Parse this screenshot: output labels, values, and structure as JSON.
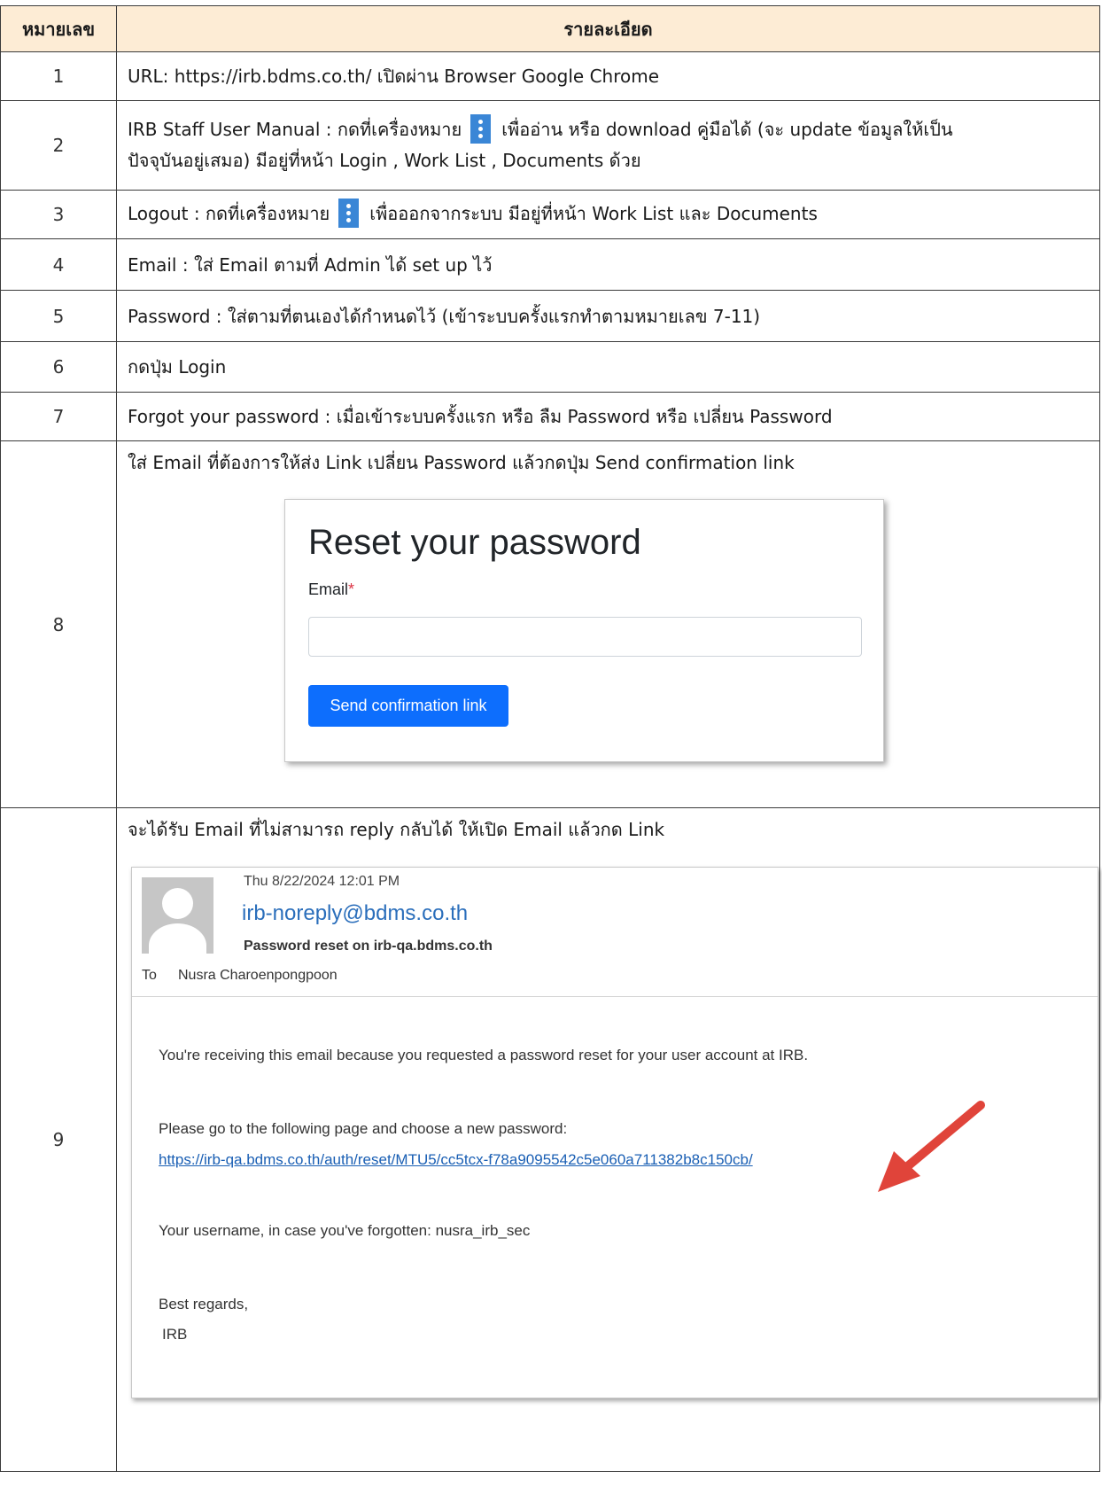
{
  "table": {
    "header": {
      "num": "หมายเลข",
      "desc": "รายละเอียด"
    },
    "rows": [
      {
        "num": "1",
        "text": "URL: https://irb.bdms.co.th/ เปิดผ่าน Browser Google Chrome"
      },
      {
        "num": "2",
        "text_before_icon": "IRB Staff User Manual : กดที่เครื่องหมาย",
        "text_after_icon": "เพื่ออ่าน หรือ download คู่มือได้ (จะ update ข้อมูลให้เป็น",
        "text_line2": "ปัจจุบันอยู่เสมอ) มีอยู่ที่หน้า Login , Work List , Documents ด้วย",
        "icon": "kebab-menu-icon"
      },
      {
        "num": "3",
        "text_before_icon": "Logout : กดที่เครื่องหมาย",
        "text_after_icon": "เพื่อออกจากระบบ มีอยู่ที่หน้า Work List และ Documents",
        "icon": "kebab-menu-icon"
      },
      {
        "num": "4",
        "text": "Email : ใส่ Email ตามที่ Admin ได้ set up ไว้"
      },
      {
        "num": "5",
        "text": "Password : ใส่ตามที่ตนเองได้กำหนดไว้ (เข้าระบบครั้งแรกทำตามหมายเลข 7-11)"
      },
      {
        "num": "6",
        "text": "กดปุ่ม Login"
      },
      {
        "num": "7",
        "text": "Forgot your password : เมื่อเข้าระบบครั้งแรก หรือ ลืม Password หรือ เปลี่ยน Password"
      },
      {
        "num": "8",
        "text": "ใส่ Email ที่ต้องการให้ส่ง Link เปลี่ยน Password แล้วกดปุ่ม Send confirmation link"
      },
      {
        "num": "9",
        "text": "จะได้รับ Email ที่ไม่สามารถ reply กลับได้ ให้เปิด Email แล้วกด Link"
      }
    ]
  },
  "reset_form": {
    "title": "Reset your password",
    "email_label": "Email",
    "required_mark": "*",
    "email_value": "",
    "button_label": "Send confirmation link",
    "button_color": "#0d6efd"
  },
  "email": {
    "date": "Thu 8/22/2024 12:01 PM",
    "from": "irb-noreply@bdms.co.th",
    "subject": "Password reset on irb-qa.bdms.co.th",
    "to_label": "To",
    "to": "Nusra Charoenpongpoon",
    "body_line1": "You're receiving this email because you requested a password reset for your user account at  IRB.",
    "body_line2": "Please go to the following page and choose a new password:",
    "link": "https://irb-qa.bdms.co.th/auth/reset/MTU5/cc5tcx-f78a9095542c5e060a711382b8c150cb/",
    "body_line3": "Your username, in case you've forgotten: nusra_irb_sec",
    "closing": "Best regards,",
    "signature": "IRB",
    "arrow_color": "#e0443a"
  },
  "colors": {
    "header_bg": "#fdecd5",
    "kebab_bg": "#3a86d6"
  }
}
